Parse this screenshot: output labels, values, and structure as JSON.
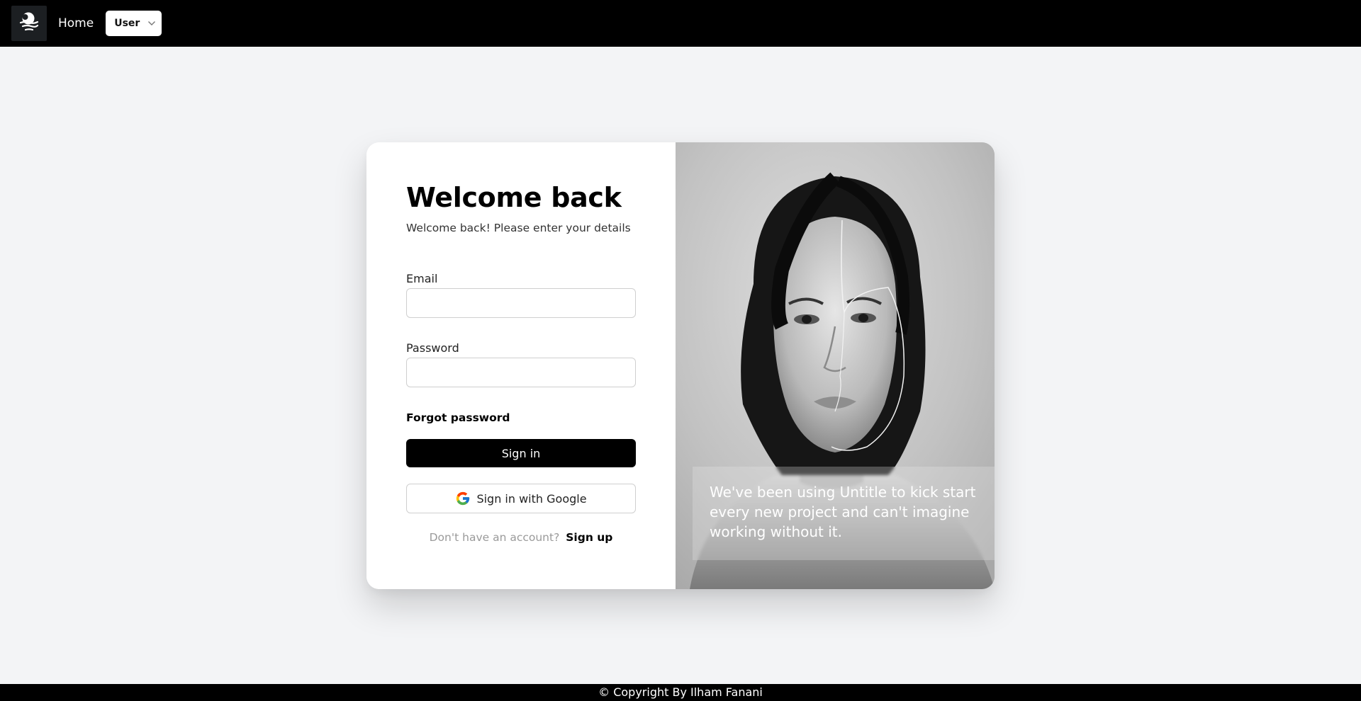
{
  "nav": {
    "logo_icon": "moon-cloud-logo-icon",
    "home_label": "Home",
    "user_label": "User"
  },
  "login": {
    "title": "Welcome back",
    "subtitle": "Welcome back! Please enter your details",
    "email_label": "Email",
    "email_value": "",
    "password_label": "Password",
    "password_value": "",
    "forgot_label": "Forgot password",
    "signin_label": "Sign in",
    "google_label": "Sign in with Google",
    "signup_prompt": "Don't have an account?",
    "signup_label": "Sign up"
  },
  "hero": {
    "quote": "We've been using Untitle to kick start every new project and can't imagine working without it."
  },
  "footer": {
    "copyright": "© Copyright By Ilham Fanani"
  },
  "colors": {
    "navbar": "#000000",
    "background": "#f3f4f6",
    "primary_button": "#000000"
  }
}
